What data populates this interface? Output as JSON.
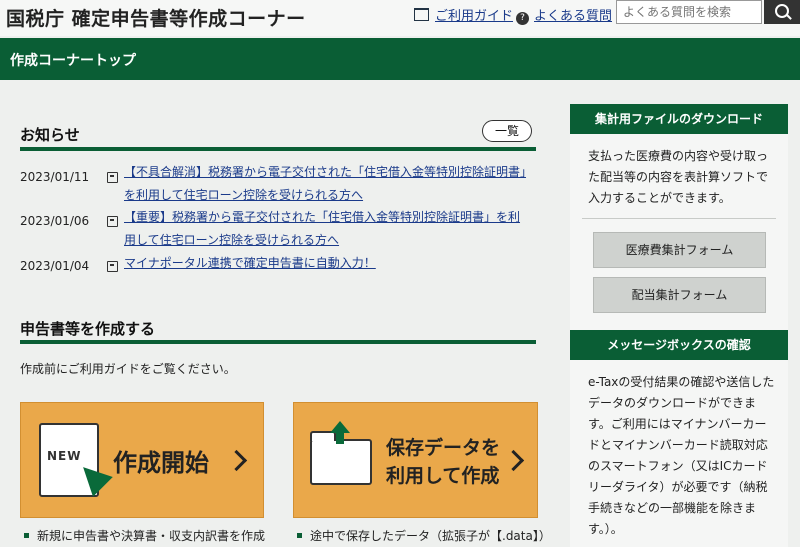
{
  "header": {
    "site_title": "国税庁 確定申告書等作成コーナー",
    "guide_link": "ご利用ガイド",
    "faq_link": "よくある質問",
    "search_placeholder": "よくある質問を検索"
  },
  "topbar": {
    "title": "作成コーナートップ"
  },
  "notices": {
    "heading": "お知らせ",
    "list_button": "一覧",
    "items": [
      {
        "date": "2023/01/11",
        "text": "【不具合解消】税務署から電子交付された「住宅借入金等特別控除証明書」を利用して住宅ローン控除を受けられる方へ"
      },
      {
        "date": "2023/01/06",
        "text": "【重要】税務署から電子交付された「住宅借入金等特別控除証明書」を利用して住宅ローン控除を受けられる方へ"
      },
      {
        "date": "2023/01/04",
        "text": "マイナポータル連携で確定申告書に自動入力！"
      }
    ]
  },
  "create": {
    "heading": "申告書等を作成する",
    "intro": "作成前にご利用ガイドをご覧ください。",
    "new_button": {
      "badge": "NEW",
      "label": "作成開始"
    },
    "saved_button": {
      "line1": "保存データを",
      "line2": "利用して作成"
    },
    "new_bullet": "新規に申告書や決算書・収支内訳書を作成",
    "saved_bullet": "途中で保存したデータ（拡張子が【.data】）"
  },
  "sidebar": {
    "download": {
      "title": "集計用ファイルのダウンロード",
      "text": "支払った医療費の内容や受け取った配当等の内容を表計算ソフトで入力することができます。",
      "buttons": [
        "医療費集計フォーム",
        "配当集計フォーム"
      ]
    },
    "message_box": {
      "title": "メッセージボックスの確認",
      "text": "e-Taxの受付結果の確認や送信したデータのダウンロードができます。ご利用にはマイナンバーカードとマイナンバーカード読取対応のスマートフォン（又はICカードリーダライタ）が必要です（納税手続きなどの一部機能を除きます。）。"
    }
  },
  "colors": {
    "brand_green": "#0a5e35",
    "accent_orange": "#eaa84a",
    "link_blue": "#1a3a8a"
  }
}
